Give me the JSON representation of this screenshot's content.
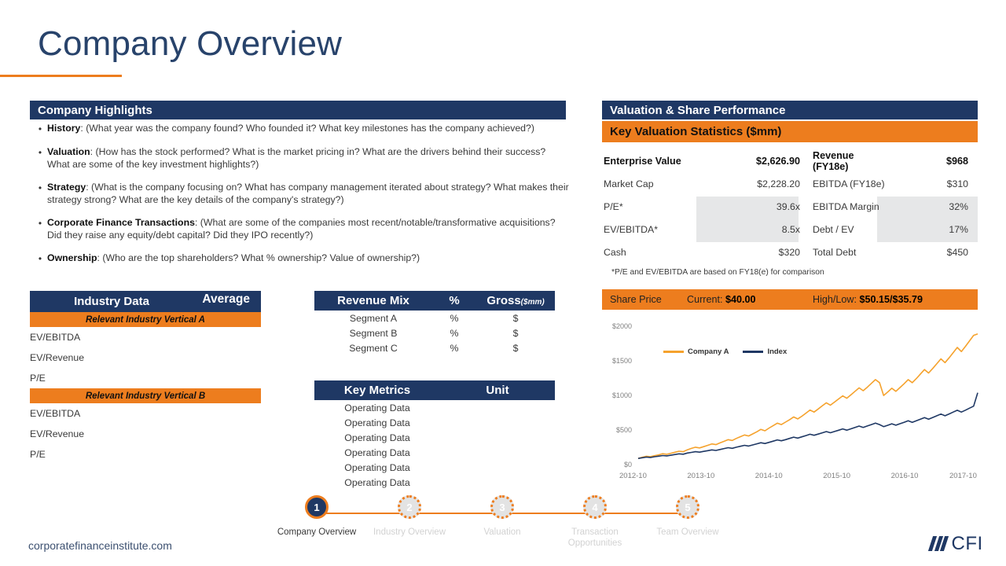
{
  "slide": {
    "title": "Company Overview",
    "site": "corporatefinanceinstitute.com",
    "logo_text": "CFI"
  },
  "highlights": {
    "header": "Company Highlights",
    "bullets": [
      {
        "term": "History",
        "text": ": (What year was the company found? Who founded it? What key milestones has the company achieved?)"
      },
      {
        "term": "Valuation",
        "text": ": (How has the stock performed? What is the market pricing in? What are the drivers behind their success? What are some of the key investment highlights?)"
      },
      {
        "term": "Strategy",
        "text": ": (What is the company focusing on? What has company management iterated about strategy? What makes their strategy strong? What are the key details of the company's strategy?)"
      },
      {
        "term": "Corporate Finance Transactions",
        "text": ": (What are some of the companies most recent/notable/transformative acquisitions? Did they raise any equity/debt capital? Did they IPO recently?)"
      },
      {
        "term": "Ownership",
        "text": ": (Who are the top shareholders? What % ownership? Value of ownership?)"
      }
    ]
  },
  "industry": {
    "header": "Industry Data",
    "average_header": "Average",
    "groups": [
      {
        "name": "Relevant Industry Vertical A",
        "rows": [
          "EV/EBITDA",
          "EV/Revenue",
          "P/E"
        ]
      },
      {
        "name": "Relevant Industry Vertical B",
        "rows": [
          "EV/EBITDA",
          "EV/Revenue",
          "P/E"
        ]
      }
    ]
  },
  "revenue_mix": {
    "header": "Revenue Mix",
    "col_pct": "%",
    "col_gross": "Gross",
    "col_gross_unit": "($mm)",
    "rows": [
      {
        "segment": "Segment A",
        "pct": "%",
        "gross": "$"
      },
      {
        "segment": "Segment B",
        "pct": "%",
        "gross": "$"
      },
      {
        "segment": "Segment C",
        "pct": "%",
        "gross": "$"
      }
    ]
  },
  "key_metrics": {
    "header": "Key Metrics",
    "col_unit": "Unit",
    "rows": [
      {
        "metric": "Operating Data",
        "unit": ""
      },
      {
        "metric": "Operating Data",
        "unit": ""
      },
      {
        "metric": "Operating Data",
        "unit": ""
      },
      {
        "metric": "Operating Data",
        "unit": ""
      },
      {
        "metric": "Operating Data",
        "unit": ""
      },
      {
        "metric": "Operating Data",
        "unit": ""
      }
    ]
  },
  "valuation": {
    "header": "Valuation & Share Performance",
    "subheader": "Key Valuation Statistics ($mm)",
    "note": "*P/E and EV/EBITDA are based on FY18(e) for comparison",
    "rows": [
      {
        "label": "Enterprise Value",
        "value": "$2,626.90",
        "label2": "Revenue (FY18e)",
        "value2": "$968"
      },
      {
        "label": "Market Cap",
        "value": "$2,228.20",
        "label2": "EBITDA (FY18e)",
        "value2": "$310"
      },
      {
        "label": "P/E*",
        "value": "39.6x",
        "label2": "EBITDA Margin",
        "value2": "32%"
      },
      {
        "label": "EV/EBITDA*",
        "value": "8.5x",
        "label2": "Debt / EV",
        "value2": "17%"
      },
      {
        "label": "Cash",
        "value": "$320",
        "label2": "Total Debt",
        "value2": "$450"
      }
    ]
  },
  "share_price": {
    "label": "Share Price",
    "current_label": "Current:",
    "current_value": "$40.00",
    "highlow_label": "High/Low:",
    "high_value": "$50.15",
    "separator": "/",
    "low_value": "$35.79"
  },
  "chart_data": {
    "type": "line",
    "title": "",
    "xlabel": "",
    "ylabel": "",
    "ylim": [
      0,
      2000
    ],
    "yticks": [
      "$0",
      "$500",
      "$1000",
      "$1500",
      "$2000"
    ],
    "ytick_values": [
      0,
      500,
      1000,
      1500,
      2000
    ],
    "xticks": [
      "2012-10",
      "2013-10",
      "2014-10",
      "2015-10",
      "2016-10",
      "2017-10"
    ],
    "grid": false,
    "legend_position": "top-center",
    "series": [
      {
        "name": "Company A",
        "color": "#F5A22D",
        "values": [
          100,
          118,
          132,
          126,
          140,
          152,
          168,
          160,
          175,
          190,
          205,
          198,
          225,
          245,
          262,
          252,
          270,
          290,
          310,
          300,
          325,
          348,
          372,
          360,
          390,
          415,
          440,
          425,
          455,
          485,
          520,
          500,
          540,
          575,
          610,
          590,
          625,
          660,
          700,
          672,
          710,
          755,
          800,
          770,
          815,
          860,
          905,
          870,
          915,
          960,
          1005,
          970,
          1020,
          1070,
          1120,
          1080,
          1130,
          1185,
          1240,
          1195,
          1010,
          1060,
          1115,
          1070,
          1125,
          1180,
          1240,
          1195,
          1255,
          1320,
          1385,
          1335,
          1400,
          1470,
          1540,
          1485,
          1555,
          1630,
          1705,
          1645,
          1720,
          1800,
          1880,
          1900
        ]
      },
      {
        "name": "Index",
        "color": "#1F3864",
        "values": [
          100,
          110,
          120,
          115,
          125,
          133,
          142,
          137,
          147,
          157,
          167,
          161,
          178,
          188,
          198,
          191,
          202,
          213,
          224,
          216,
          230,
          243,
          256,
          247,
          262,
          276,
          290,
          280,
          295,
          311,
          327,
          316,
          333,
          350,
          368,
          356,
          372,
          390,
          408,
          394,
          412,
          431,
          450,
          435,
          452,
          470,
          489,
          472,
          490,
          508,
          527,
          509,
          528,
          548,
          568,
          549,
          569,
          590,
          611,
          590,
          560,
          580,
          601,
          581,
          602,
          623,
          645,
          623,
          645,
          668,
          691,
          668,
          692,
          717,
          742,
          717,
          743,
          770,
          797,
          770,
          798,
          827,
          856,
          1050
        ]
      }
    ]
  },
  "stepper": {
    "steps": [
      {
        "number": "1",
        "label": "Company Overview",
        "active": true
      },
      {
        "number": "2",
        "label": "Industry Overview",
        "active": false
      },
      {
        "number": "3",
        "label": "Valuation",
        "active": false
      },
      {
        "number": "4",
        "label": "Transaction Opportunities",
        "active": false
      },
      {
        "number": "5",
        "label": "Team Overview",
        "active": false
      }
    ]
  },
  "colors": {
    "navy": "#1F3864",
    "orange": "#ED7D1E",
    "title_navy": "#28436b",
    "shade_grey": "#E6E7E8",
    "series_orange": "#F5A22D"
  }
}
